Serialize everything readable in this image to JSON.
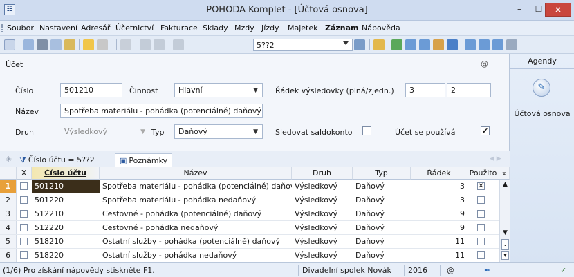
{
  "window": {
    "title": "POHODA Komplet - [Účtová osnova]",
    "app_icon": "pohoda-app-icon",
    "min": "–",
    "max": "☐",
    "close": "×"
  },
  "menu": [
    "Soubor",
    "Nastavení",
    "Adresář",
    "Účetnictví",
    "Fakturace",
    "Sklady",
    "Mzdy",
    "Jízdy",
    "Majetek",
    "Záznam",
    "Nápověda"
  ],
  "toolbar": {
    "filter_value": "5??2"
  },
  "form": {
    "section": "Účet",
    "cislo_label": "Číslo",
    "cislo_value": "501210",
    "cinnost_label": "Činnost",
    "cinnost_value": "Hlavní",
    "radek_label": "Řádek výsledovky (plná/zjedn.)",
    "radek_full": "3",
    "radek_short": "2",
    "nazev_label": "Název",
    "nazev_value": "Spotřeba materiálu - pohádka (potenciálně) daňový",
    "druh_label": "Druh",
    "druh_value": "Výsledkový",
    "typ_label": "Typ",
    "typ_value": "Daňový",
    "saldo_label": "Sledovat saldokonto",
    "saldo_checked": false,
    "pouziva_label": "Účet se používá",
    "pouziva_checked": true,
    "at_symbol": "@"
  },
  "agendy": {
    "header": "Agendy",
    "item": "Účtová osnova"
  },
  "tabs": {
    "filter_tab": "Číslo účtu = 5??2",
    "notes_tab": "Poznámky"
  },
  "grid": {
    "columns": [
      "X",
      "Číslo účtu",
      "Název",
      "Druh",
      "Typ",
      "Řádek",
      "Použito"
    ],
    "rows": [
      {
        "n": "1",
        "cislo": "501210",
        "nazev": "Spotřeba materiálu - pohádka (potenciálně) daňov",
        "druh": "Výsledkový",
        "typ": "Daňový",
        "radek": "3",
        "pouzito": "☒"
      },
      {
        "n": "2",
        "cislo": "501220",
        "nazev": "Spotřeba materiálu - pohádka nedaňový",
        "druh": "Výsledkový",
        "typ": "Daňový",
        "radek": "3",
        "pouzito": ""
      },
      {
        "n": "3",
        "cislo": "512210",
        "nazev": "Cestovné - pohádka (potenciálně) daňový",
        "druh": "Výsledkový",
        "typ": "Daňový",
        "radek": "9",
        "pouzito": ""
      },
      {
        "n": "4",
        "cislo": "512220",
        "nazev": "Cestovné - pohádka nedaňový",
        "druh": "Výsledkový",
        "typ": "Daňový",
        "radek": "9",
        "pouzito": ""
      },
      {
        "n": "5",
        "cislo": "518210",
        "nazev": "Ostatní služby - pohádka (potenciálně) daňový",
        "druh": "Výsledkový",
        "typ": "Daňový",
        "radek": "11",
        "pouzito": ""
      },
      {
        "n": "6",
        "cislo": "518220",
        "nazev": "Ostatní služby - pohádka nedaňový",
        "druh": "Výsledkový",
        "typ": "Daňový",
        "radek": "11",
        "pouzito": ""
      }
    ]
  },
  "status": {
    "help": "(1/6) Pro získání nápovědy stiskněte F1.",
    "company": "Divadelní spolek Novák",
    "year": "2016",
    "at": "@"
  }
}
